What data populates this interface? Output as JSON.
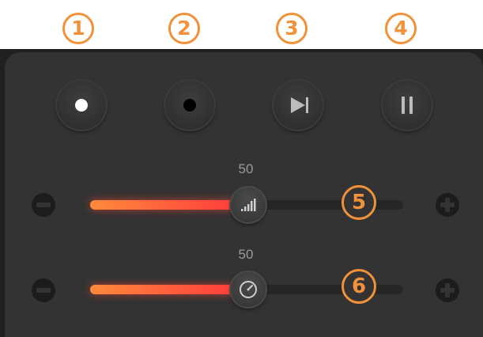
{
  "callouts": {
    "c1": "1",
    "c2": "2",
    "c3": "3",
    "c4": "4",
    "c5": "5",
    "c6": "6"
  },
  "buttons": [
    {
      "name": "white-record-button",
      "icon": "white-dot-icon"
    },
    {
      "name": "black-record-button",
      "icon": "black-dot-icon"
    },
    {
      "name": "skip-forward-button",
      "icon": "skip-forward-icon"
    },
    {
      "name": "pause-button",
      "icon": "pause-icon"
    }
  ],
  "sliders": {
    "volume": {
      "value_label": "50",
      "value": 50,
      "min": 0,
      "max": 100,
      "icon": "signal-bars-icon"
    },
    "speed": {
      "value_label": "50",
      "value": 50,
      "min": 0,
      "max": 100,
      "icon": "speedometer-icon"
    }
  },
  "colors": {
    "accent": "#f0923a",
    "fill_start": "#ff8a3c",
    "fill_end": "#ff3d3d",
    "panel": "#333333",
    "panel_dark": "#202020"
  }
}
